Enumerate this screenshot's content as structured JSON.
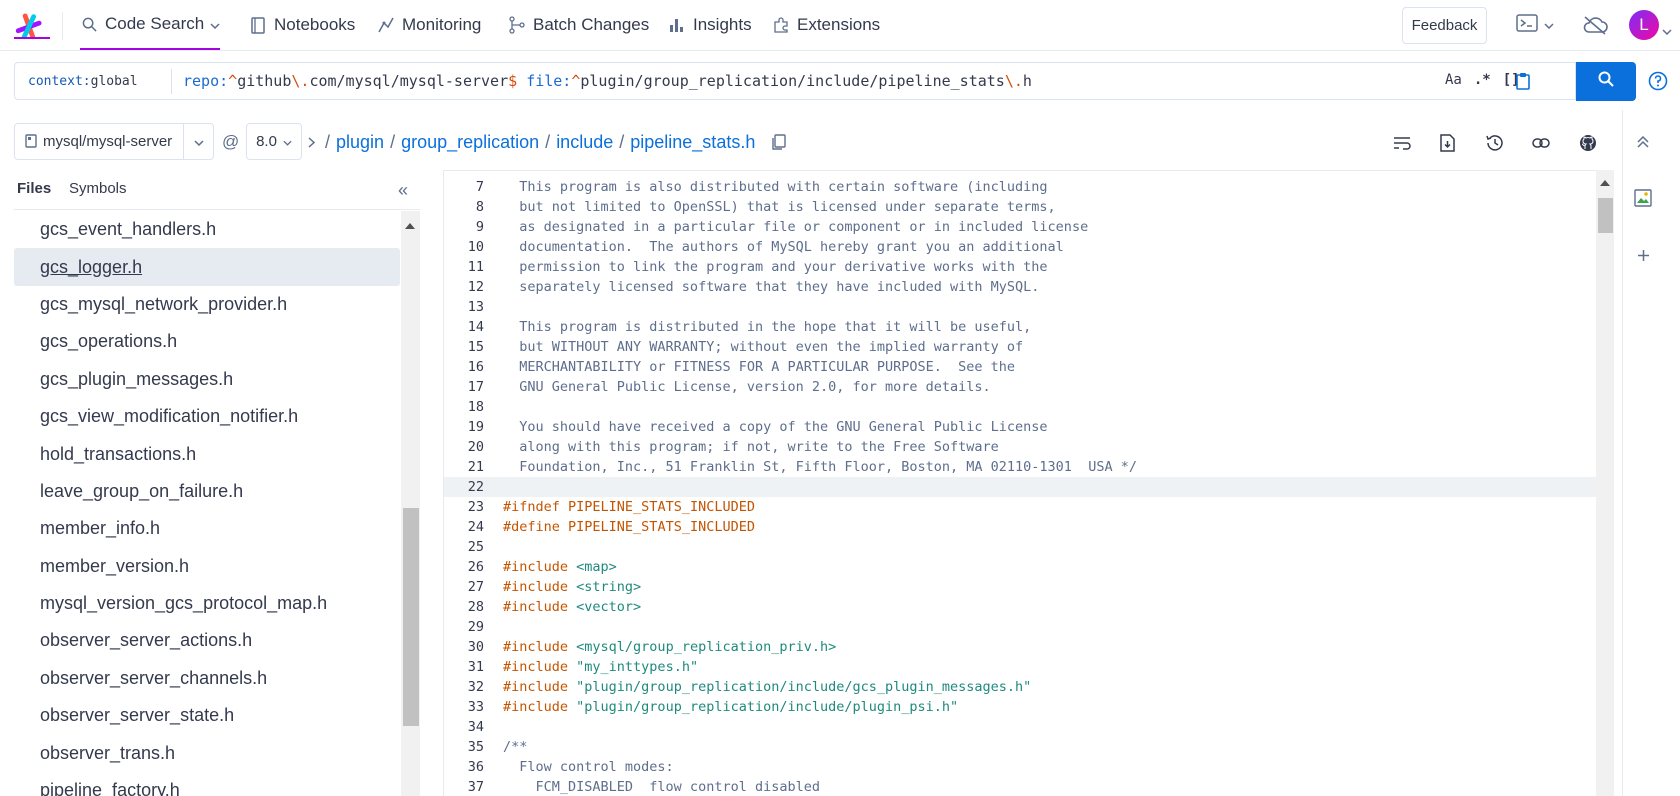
{
  "nav": {
    "items": [
      {
        "label": "Code Search",
        "icon": "search-icon"
      },
      {
        "label": "Notebooks",
        "icon": "notebook-icon"
      },
      {
        "label": "Monitoring",
        "icon": "monitoring-icon"
      },
      {
        "label": "Batch Changes",
        "icon": "batch-changes-icon"
      },
      {
        "label": "Insights",
        "icon": "insights-icon"
      },
      {
        "label": "Extensions",
        "icon": "puzzle-icon"
      }
    ],
    "feedback_label": "Feedback",
    "avatar_letter": "L"
  },
  "search": {
    "context_key": "context:",
    "context_value": "global",
    "query": {
      "repo_kw": "repo:",
      "repo_caret": "^",
      "repo_a": "github",
      "repo_esc": "\\.",
      "repo_b": "com/mysql/mysql-server",
      "repo_dollar": "$",
      "file_kw": "file:",
      "file_caret": "^",
      "file_a": "plugin/group_replication/include/pipeline_stats",
      "file_esc": "\\.",
      "file_b": "h"
    },
    "opt_case": "Aa",
    "opt_regex": ".*",
    "opt_structural": "[]"
  },
  "breadcrumb": {
    "repo": "mysql/mysql-server",
    "at": "@",
    "revision": "8.0",
    "path": [
      "plugin",
      "group_replication",
      "include",
      "pipeline_stats.h"
    ]
  },
  "sidebar": {
    "tab_files": "Files",
    "tab_symbols": "Symbols",
    "collapse": "«",
    "files": [
      "gcs_event_handlers.h",
      "gcs_logger.h",
      "gcs_mysql_network_provider.h",
      "gcs_operations.h",
      "gcs_plugin_messages.h",
      "gcs_view_modification_notifier.h",
      "hold_transactions.h",
      "leave_group_on_failure.h",
      "member_info.h",
      "member_version.h",
      "mysql_version_gcs_protocol_map.h",
      "observer_server_actions.h",
      "observer_server_channels.h",
      "observer_server_state.h",
      "observer_trans.h",
      "pipeline_factory.h"
    ],
    "selected_file": "gcs_logger.h"
  },
  "code": {
    "lines": [
      {
        "n": "7",
        "t": "  This program is also distributed with certain software (including"
      },
      {
        "n": "8",
        "t": "  but not limited to OpenSSL) that is licensed under separate terms,"
      },
      {
        "n": "9",
        "t": "  as designated in a particular file or component or in included license"
      },
      {
        "n": "10",
        "t": "  documentation.  The authors of MySQL hereby grant you an additional"
      },
      {
        "n": "11",
        "t": "  permission to link the program and your derivative works with the"
      },
      {
        "n": "12",
        "t": "  separately licensed software that they have included with MySQL."
      },
      {
        "n": "13",
        "t": ""
      },
      {
        "n": "14",
        "t": "  This program is distributed in the hope that it will be useful,"
      },
      {
        "n": "15",
        "t": "  but WITHOUT ANY WARRANTY; without even the implied warranty of"
      },
      {
        "n": "16",
        "t": "  MERCHANTABILITY or FITNESS FOR A PARTICULAR PURPOSE.  See the"
      },
      {
        "n": "17",
        "t": "  GNU General Public License, version 2.0, for more details."
      },
      {
        "n": "18",
        "t": ""
      },
      {
        "n": "19",
        "t": "  You should have received a copy of the GNU General Public License"
      },
      {
        "n": "20",
        "t": "  along with this program; if not, write to the Free Software"
      },
      {
        "n": "21",
        "t": "  Foundation, Inc., 51 Franklin St, Fifth Floor, Boston, MA 02110-1301  USA */"
      },
      {
        "n": "22",
        "t": "",
        "hl": true
      },
      {
        "n": "23",
        "pp": "#ifndef",
        "t": " PIPELINE_STATS_INCLUDED",
        "kind": "macro"
      },
      {
        "n": "24",
        "pp": "#define",
        "t": " PIPELINE_STATS_INCLUDED",
        "kind": "macro"
      },
      {
        "n": "25",
        "t": ""
      },
      {
        "n": "26",
        "pp": "#include",
        "s": " <map>"
      },
      {
        "n": "27",
        "pp": "#include",
        "s": " <string>"
      },
      {
        "n": "28",
        "pp": "#include",
        "s": " <vector>"
      },
      {
        "n": "29",
        "t": ""
      },
      {
        "n": "30",
        "pp": "#include",
        "s": " <mysql/group_replication_priv.h>"
      },
      {
        "n": "31",
        "pp": "#include",
        "s": " \"my_inttypes.h\""
      },
      {
        "n": "32",
        "pp": "#include",
        "s": " \"plugin/group_replication/include/gcs_plugin_messages.h\""
      },
      {
        "n": "33",
        "pp": "#include",
        "s": " \"plugin/group_replication/include/plugin_psi.h\""
      },
      {
        "n": "34",
        "t": ""
      },
      {
        "n": "35",
        "t": "/**"
      },
      {
        "n": "36",
        "t": "  Flow control modes:"
      },
      {
        "n": "37",
        "t": "    FCM_DISABLED  flow control disabled"
      }
    ]
  },
  "colors": {
    "accent": "#a305e1",
    "link": "#0b70db",
    "preprocessor": "#c45500",
    "string": "#1f8a7d"
  }
}
